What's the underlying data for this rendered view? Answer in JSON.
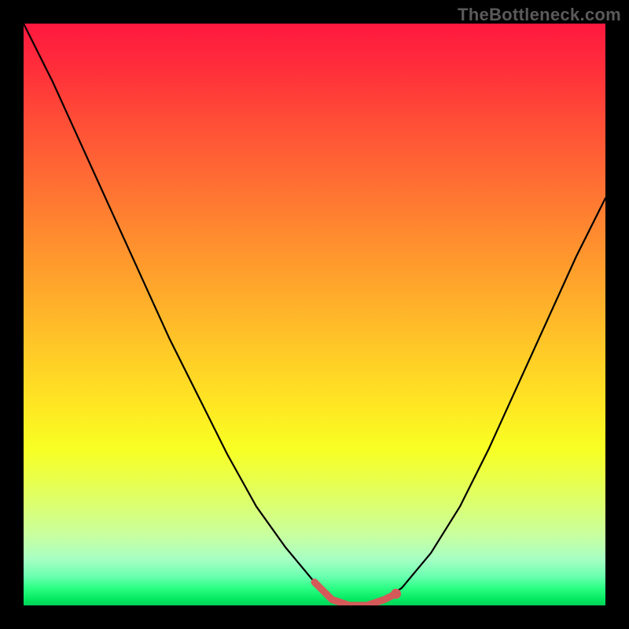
{
  "watermark": "TheBottleneck.com",
  "chart_data": {
    "type": "line",
    "title": "",
    "xlabel": "",
    "ylabel": "",
    "xlim": [
      0,
      100
    ],
    "ylim": [
      0,
      100
    ],
    "grid": false,
    "series": [
      {
        "name": "curve",
        "x": [
          0,
          5,
          10,
          15,
          20,
          25,
          30,
          35,
          40,
          45,
          50,
          53,
          56,
          59,
          62,
          65,
          70,
          75,
          80,
          85,
          90,
          95,
          100
        ],
        "y": [
          100,
          90,
          79,
          68,
          57,
          46,
          36,
          26,
          17,
          10,
          4,
          1,
          0,
          0,
          1,
          3,
          9,
          17,
          27,
          38,
          49,
          60,
          70
        ]
      }
    ],
    "emphasis": {
      "name": "trough-segment",
      "x": [
        50,
        53,
        56,
        59,
        62,
        64
      ],
      "y": [
        4,
        1,
        0,
        0,
        1,
        2
      ],
      "color": "#d45a5a"
    },
    "background_gradient": {
      "top": "#ff183f",
      "mid": "#ffe823",
      "bottom": "#03d157"
    }
  }
}
